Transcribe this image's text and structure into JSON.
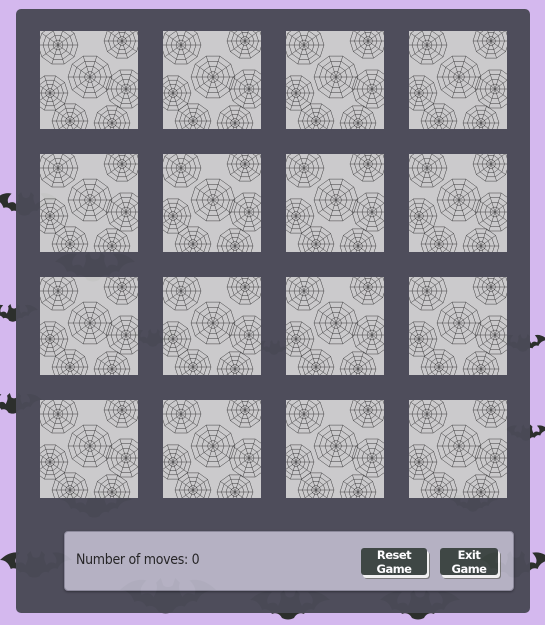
{
  "game": {
    "card_count": 16,
    "rows": 4,
    "columns": 4,
    "card_back": "spider-web-pattern"
  },
  "status": {
    "moves_label": "Number of moves:",
    "moves_value": "0"
  },
  "controls": {
    "reset_label": "Reset Game",
    "exit_label": "Exit Game"
  },
  "colors": {
    "background": "#d4b8ee",
    "board": "#4a4a57",
    "panel": "#b4b1c2",
    "button": "#3b4440"
  }
}
